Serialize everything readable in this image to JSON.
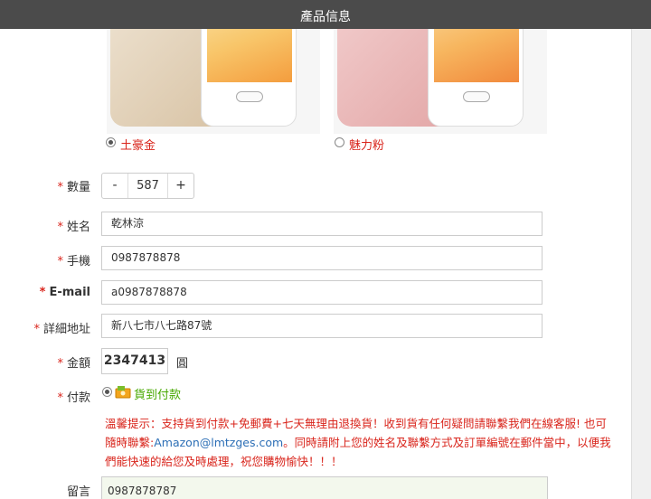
{
  "header": {
    "title": "產品信息"
  },
  "colors": {
    "options": [
      {
        "label": "土豪金",
        "selected": true
      },
      {
        "label": "魅力粉",
        "selected": false
      }
    ]
  },
  "form": {
    "quantity": {
      "label": "數量",
      "value": "587",
      "minus": "-",
      "plus": "+"
    },
    "name": {
      "label": "姓名",
      "value": "乾林涼"
    },
    "phone": {
      "label": "手機",
      "value": "0987878878"
    },
    "email": {
      "label": "E-mail",
      "value": "a0987878878"
    },
    "address": {
      "label": "詳細地址",
      "value": "新八七市八七路87號"
    },
    "amount": {
      "label": "金額",
      "value": "2347413",
      "unit": "圓"
    },
    "payment": {
      "label": "付款",
      "option": "貨到付款"
    },
    "required_mark": "*"
  },
  "notice": {
    "line1": "溫馨提示：支持貨到付款+免郵費+七天無理由退換貨！收到貨有任何疑問請聯繫我們在線客服! 也可隨時聯繫:",
    "email": "Amazon@lmtzges.com",
    "line2": "。同時請附上您的姓名及聯繫方式及訂單編號在郵件當中，以便我們能快速的給您及時處理，祝您購物愉快！！！"
  },
  "remark": {
    "label": "留言",
    "value": "0987878787"
  }
}
